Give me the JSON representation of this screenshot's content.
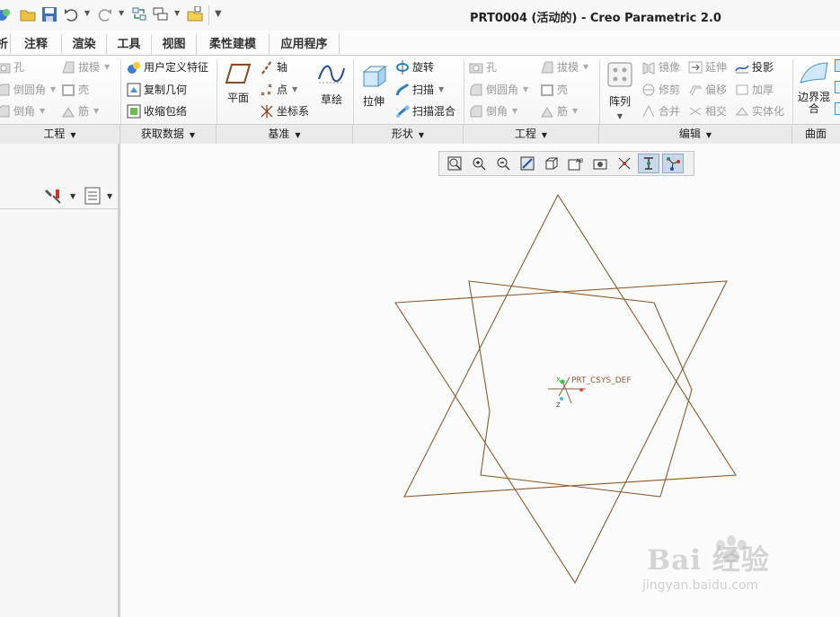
{
  "window": {
    "title": "PRT0004 (活动的) - Creo Parametric 2.0"
  },
  "quick_access": {
    "icons": [
      "new-icon",
      "open-icon",
      "save-icon",
      "undo-icon",
      "redo-icon",
      "regenerate-icon",
      "windows-icon",
      "close-icon"
    ]
  },
  "tabs": [
    "析",
    "注释",
    "渲染",
    "工具",
    "视图",
    "柔性建模",
    "应用程序"
  ],
  "ribbon": {
    "engineering_left": {
      "hole": "孔",
      "draft": "拔模",
      "round": "倒圆角",
      "shell": "壳",
      "chamfer": "倒角",
      "rib": "筋"
    },
    "get_data": {
      "udf": "用户定义特征",
      "copy_geom": "复制几何",
      "shrinkwrap": "收缩包络"
    },
    "datum": {
      "plane": "平面",
      "axis": "轴",
      "point": "点",
      "csys": "坐标系",
      "sketch": "草绘"
    },
    "shapes": {
      "extrude": "拉伸",
      "revolve": "旋转",
      "sweep": "扫描",
      "swept_blend": "扫描混合"
    },
    "engineering_right": {
      "hole": "孔",
      "draft": "拔模",
      "round": "倒圆角",
      "shell": "壳",
      "chamfer": "倒角",
      "rib": "筋"
    },
    "pattern": "阵列",
    "editing": {
      "mirror": "镜像",
      "extend": "延伸",
      "project": "投影",
      "trim": "修剪",
      "offset": "偏移",
      "thicken": "加厚",
      "merge": "合并",
      "intersect": "相交",
      "solidify": "实体化"
    },
    "surfaces": {
      "boundary_blend": "边界混合"
    },
    "group_labels": {
      "engineering": "工程",
      "get_data": "获取数据",
      "datum": "基准",
      "shapes": "形状",
      "engineering2": "工程",
      "editing": "编辑",
      "surfaces": "曲面"
    }
  },
  "graphics": {
    "csys_name": "PRT_CSYS_DEF",
    "csys_x": "X",
    "csys_z": "Z",
    "curve_color": "#8b5a2b"
  },
  "watermark": {
    "brand": "Bai 经验",
    "url": "jingyan.baidu.com"
  }
}
